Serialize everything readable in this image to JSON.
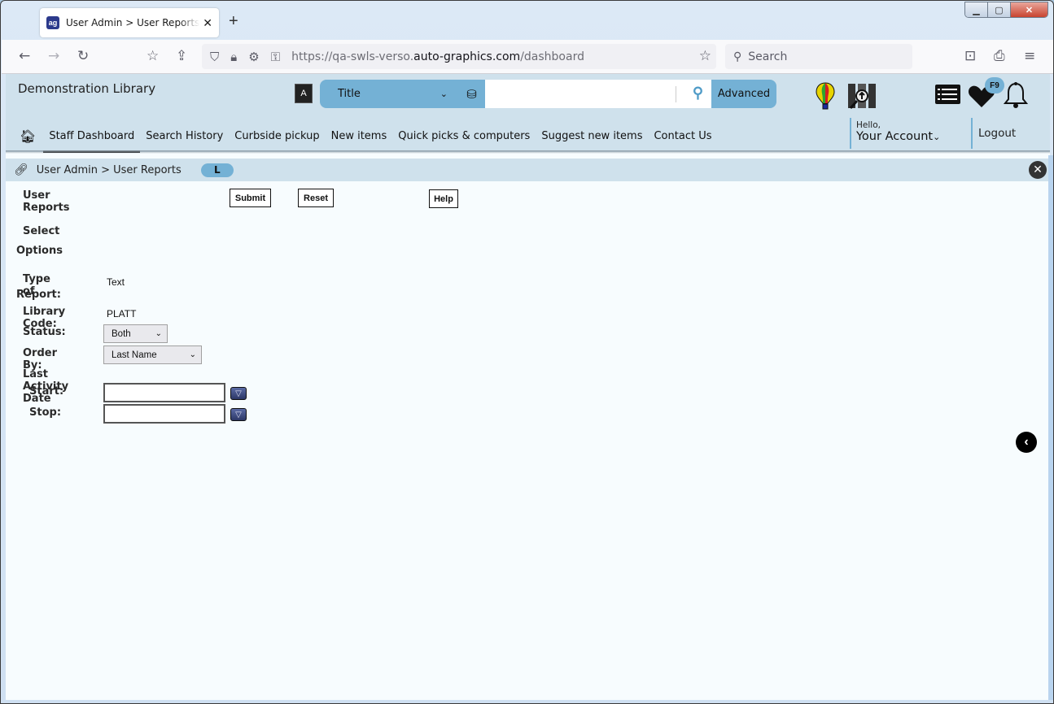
{
  "browser": {
    "tab_title": "User Admin > User Reports | SWLS",
    "tab_favicon": "ag",
    "url_prefix": "https://qa-swls-verso.",
    "url_domain": "auto-graphics.com",
    "url_path": "/dashboard",
    "search_placeholder": "Search",
    "icons": [
      "back-icon",
      "forward-icon",
      "reload-icon",
      "bookmark-icon",
      "share-icon",
      "shield-icon",
      "lock-icon",
      "permissions-icon",
      "key-icon",
      "star-icon",
      "pocket-icon",
      "print-icon",
      "menu-icon"
    ]
  },
  "header": {
    "library_name": "Demonstration Library",
    "search_type": "Title",
    "search_value": "",
    "advanced_label": "Advanced",
    "badge": "F9",
    "hello": "Hello,",
    "account_label": "Your Account",
    "logout_label": "Logout"
  },
  "nav": {
    "items": [
      {
        "label": "Staff Dashboard",
        "active": true
      },
      {
        "label": "Search History"
      },
      {
        "label": "Curbside pickup"
      },
      {
        "label": "New items"
      },
      {
        "label": "Quick picks & computers"
      },
      {
        "label": "Suggest new items"
      },
      {
        "label": "Contact Us"
      }
    ]
  },
  "breadcrumb": {
    "text": "User Admin > User Reports",
    "pill": "L"
  },
  "form": {
    "title": "User Reports",
    "submit_label": "Submit",
    "reset_label": "Reset",
    "help_label": "Help",
    "select_label": "Select",
    "options_label": "Options",
    "type_label_1": "Type of",
    "type_label_2": "Report:",
    "type_value": "Text",
    "library_code_label": "Library Code:",
    "library_code_value": "PLATT",
    "status_label": "Status:",
    "status_value": "Both",
    "order_label": "Order By:",
    "order_value": "Last Name",
    "last_activity_label": "Last Activity Date",
    "start_label": "Start:",
    "start_value": "",
    "stop_label": "Stop:",
    "stop_value": ""
  },
  "colors": {
    "header_bg": "#cfe1ec",
    "accent": "#74b1d5",
    "page_bg": "#f7fcfe"
  }
}
